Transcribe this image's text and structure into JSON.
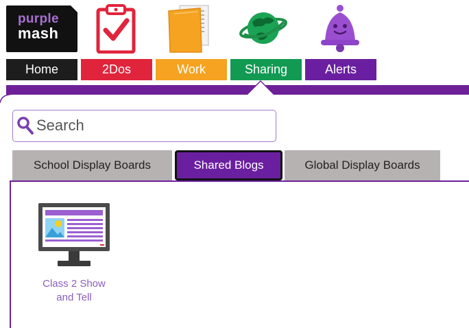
{
  "logo": {
    "line1": "purple",
    "line2": "mash"
  },
  "nav": {
    "home": "Home",
    "todos": "2Dos",
    "work": "Work",
    "sharing": "Sharing",
    "alerts": "Alerts"
  },
  "icons": {
    "todos": "clipboard-check-icon",
    "work": "folder-icon",
    "sharing": "globe-icon",
    "alerts": "bell-icon"
  },
  "search": {
    "placeholder": "Search",
    "value": ""
  },
  "tabs": {
    "school": "School Display Boards",
    "shared": "Shared Blogs",
    "global": "Global Display Boards",
    "active": "Shared Blogs"
  },
  "items": [
    {
      "title": "Class 2 Show and Tell",
      "icon": "monitor-blog-icon"
    }
  ],
  "colors": {
    "brand_purple": "#6a1fa0",
    "home": "#1d1d1d",
    "todos": "#e0243c",
    "work": "#f5a320",
    "sharing": "#129a52",
    "alerts": "#6a1fa0",
    "tab_grey": "#b6b2b2"
  }
}
